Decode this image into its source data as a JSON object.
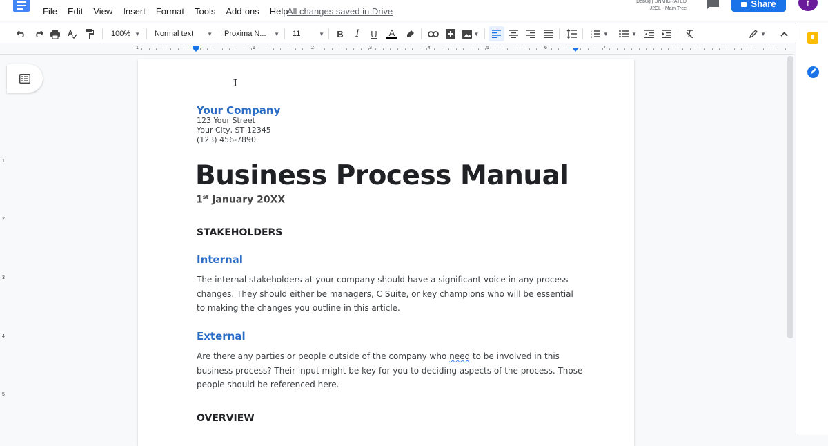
{
  "menu": [
    "File",
    "Edit",
    "View",
    "Insert",
    "Format",
    "Tools",
    "Add-ons",
    "Help"
  ],
  "save_status": "All changes saved in Drive",
  "debug": {
    "line1": "Debug | UNMIGRATED",
    "line2": "J2CL - Main Tree"
  },
  "share_label": "Share",
  "avatar_letter": "t",
  "toolbar": {
    "zoom": "100%",
    "style": "Normal text",
    "font": "Proxima N...",
    "size": "11",
    "bold": "B",
    "italic": "I",
    "underline": "U",
    "text_color": "A"
  },
  "ruler": {
    "h": [
      "1",
      "1",
      "2",
      "3",
      "4",
      "5",
      "6",
      "7"
    ],
    "v": [
      "1",
      "2",
      "3",
      "4",
      "5"
    ]
  },
  "document": {
    "company": "Your Company",
    "address": [
      "123 Your Street",
      "Your City, ST 12345",
      "(123) 456-7890"
    ],
    "title": "Business Process Manual",
    "date_day": "1",
    "date_sup": "st",
    "date_rest": " January 20XX",
    "heading1": "STAKEHOLDERS",
    "internal_heading": "Internal",
    "internal_text": "The internal stakeholders at your company should have a significant voice in any process changes. They should either be managers, C Suite, or key champions who will be essential to making the changes you outline in this article.",
    "external_heading": "External",
    "external_text_a": "Are there any parties or people outside of the company who ",
    "external_text_err": "need",
    "external_text_b": " to be involved in this business process? Their input might be key for you to deciding aspects of the process. Those people should be referenced here.",
    "heading2": "OVERVIEW"
  },
  "colors": {
    "accent": "#1a73e8",
    "heading_blue": "#2b6cc6",
    "avatar": "#6a1b9a",
    "keep": "#fbbc04"
  }
}
